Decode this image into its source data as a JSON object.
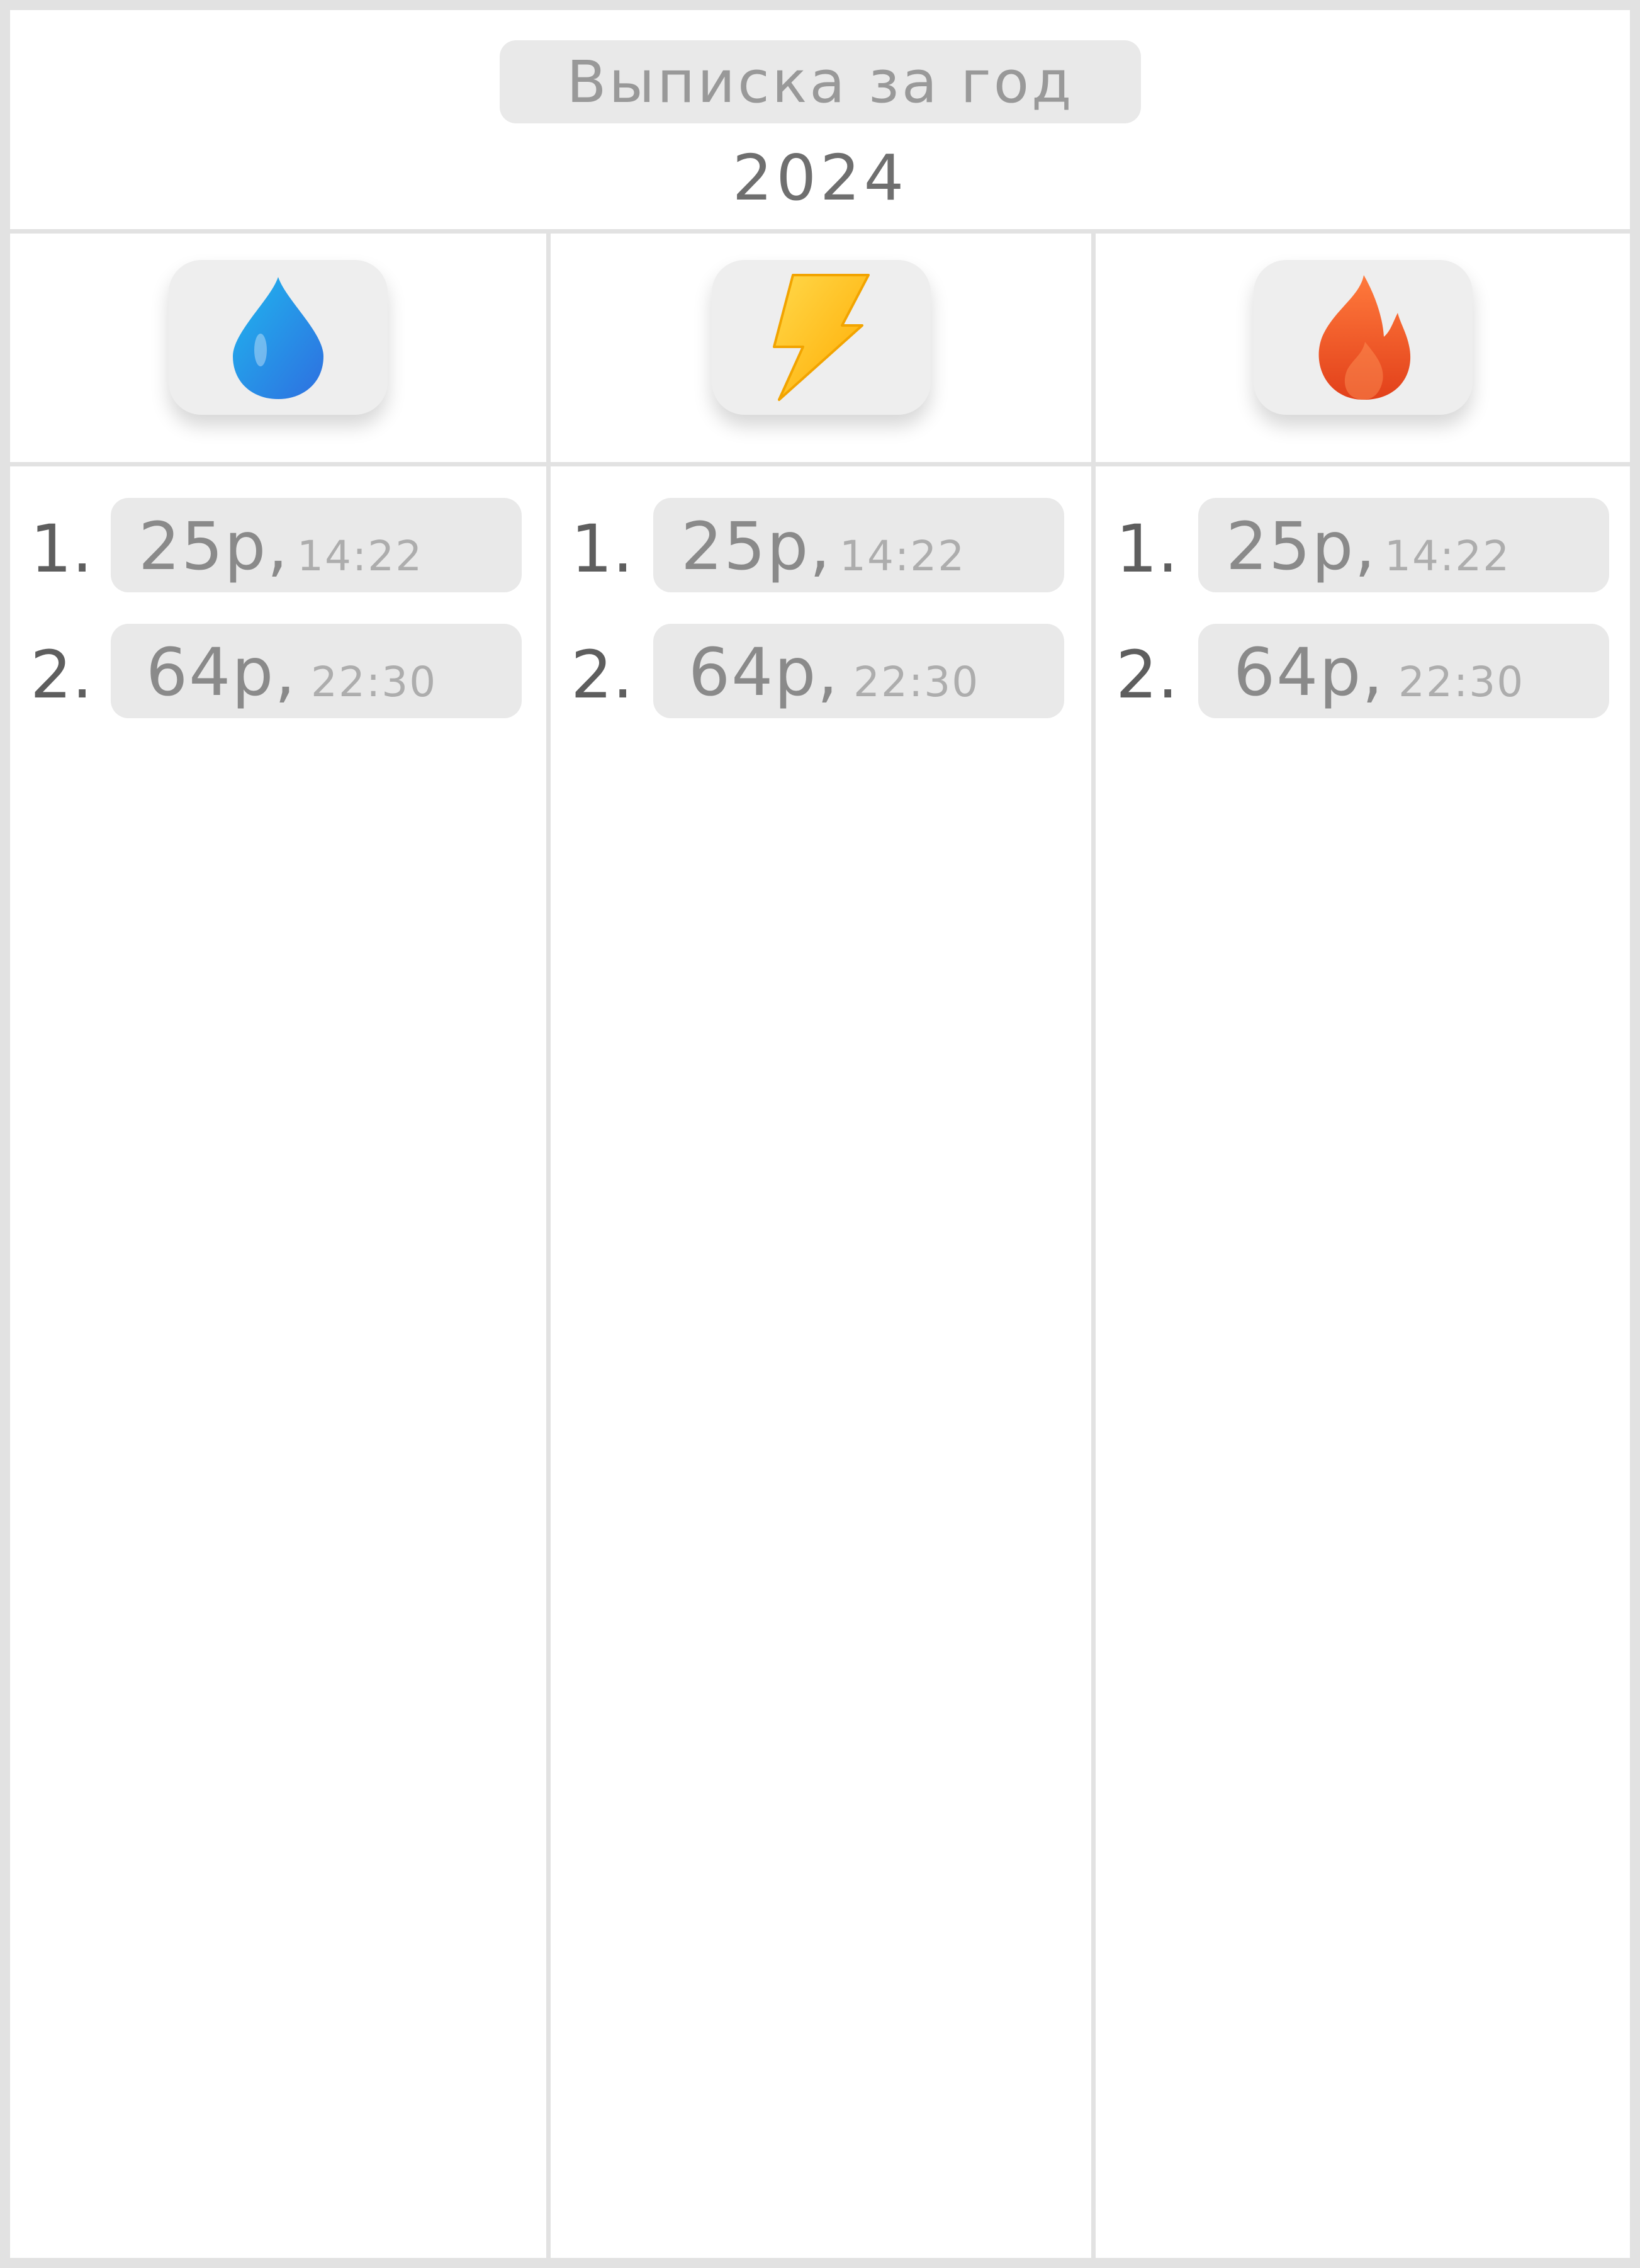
{
  "header": {
    "title": "Выписка за год",
    "year": "2024"
  },
  "colors": {
    "background": "#ffffff",
    "frame": "#e2e2e2",
    "pill": "#e9e9e9",
    "water": "#2f8fe6",
    "electricity": "#ffc400",
    "gas": "#ef5420"
  },
  "columns": [
    {
      "icon": "water-drop-icon",
      "entries": [
        {
          "index": "1.",
          "amount": "25р,",
          "time": "14:22"
        },
        {
          "index": "2.",
          "amount": "64р,",
          "time": "22:30"
        }
      ]
    },
    {
      "icon": "lightning-icon",
      "entries": [
        {
          "index": "1.",
          "amount": "25р,",
          "time": "14:22"
        },
        {
          "index": "2.",
          "amount": "64р,",
          "time": "22:30"
        }
      ]
    },
    {
      "icon": "fire-icon",
      "entries": [
        {
          "index": "1.",
          "amount": "25р,",
          "time": "14:22"
        },
        {
          "index": "2.",
          "amount": "64р,",
          "time": "22:30"
        }
      ]
    }
  ]
}
